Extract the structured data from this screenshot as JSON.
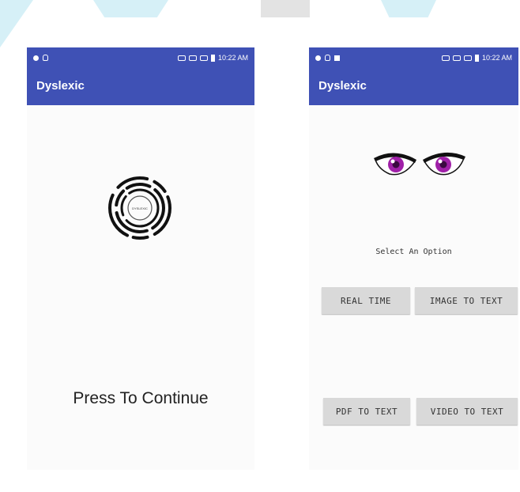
{
  "left_screen": {
    "status_time": "10:22 AM",
    "app_title": "Dyslexic",
    "logo_text": "DYSLEXIC",
    "continue_label": "Press To Continue"
  },
  "right_screen": {
    "status_time": "10:22 AM",
    "app_title": "Dyslexic",
    "select_label": "Select An Option",
    "buttons": {
      "real_time": "REAL TIME",
      "image_to_text": "IMAGE TO TEXT",
      "pdf_to_text": "PDF TO TEXT",
      "video_to_text": "VIDEO TO TEXT"
    }
  },
  "colors": {
    "app_bar": "#3f51b5",
    "button_bg": "#d9d9d9",
    "eye_iris": "#a020a8"
  }
}
